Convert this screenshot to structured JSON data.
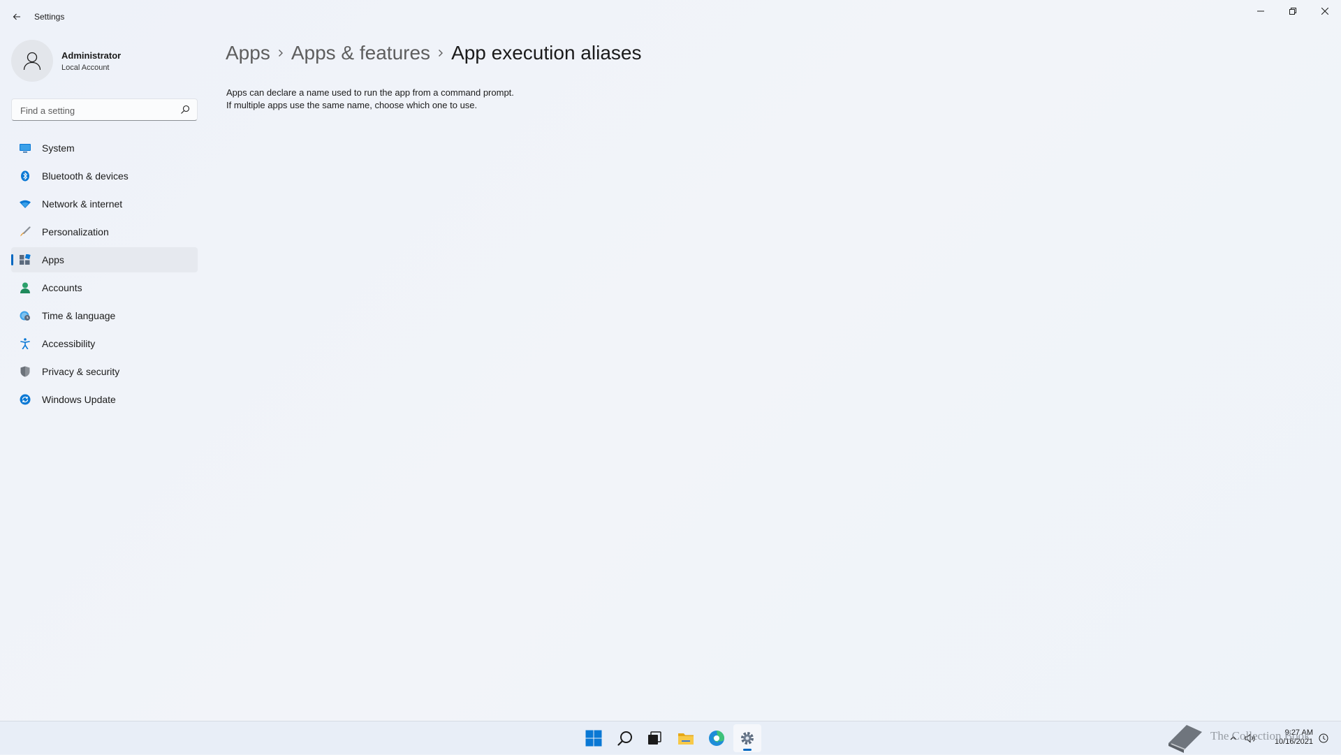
{
  "window": {
    "title": "Settings"
  },
  "profile": {
    "name": "Administrator",
    "account_type": "Local Account"
  },
  "search": {
    "placeholder": "Find a setting",
    "value": ""
  },
  "nav": {
    "items": [
      {
        "label": "System",
        "icon": "monitor-icon",
        "selected": false
      },
      {
        "label": "Bluetooth & devices",
        "icon": "bluetooth-icon",
        "selected": false
      },
      {
        "label": "Network & internet",
        "icon": "wifi-icon",
        "selected": false
      },
      {
        "label": "Personalization",
        "icon": "brush-icon",
        "selected": false
      },
      {
        "label": "Apps",
        "icon": "apps-icon",
        "selected": true
      },
      {
        "label": "Accounts",
        "icon": "person-icon",
        "selected": false
      },
      {
        "label": "Time & language",
        "icon": "globe-clock-icon",
        "selected": false
      },
      {
        "label": "Accessibility",
        "icon": "accessibility-icon",
        "selected": false
      },
      {
        "label": "Privacy & security",
        "icon": "shield-icon",
        "selected": false
      },
      {
        "label": "Windows Update",
        "icon": "update-icon",
        "selected": false
      }
    ]
  },
  "breadcrumb": {
    "items": [
      "Apps",
      "Apps & features",
      "App execution aliases"
    ]
  },
  "content": {
    "description_line1": "Apps can declare a name used to run the app from a command prompt.",
    "description_line2": "If multiple apps use the same name, choose which one to use."
  },
  "taskbar": {
    "apps": [
      "start-icon",
      "search-icon",
      "task-view-icon",
      "file-explorer-icon",
      "edge-icon",
      "settings-icon"
    ],
    "active_app": "settings-icon",
    "clock": {
      "time": "9:27 AM",
      "date": "10/16/2021"
    }
  },
  "watermark": {
    "text": "The Collection Book"
  },
  "colors": {
    "accent": "#0067c0",
    "background": "#eef2f8",
    "selected_nav": "#e6e9ef"
  }
}
